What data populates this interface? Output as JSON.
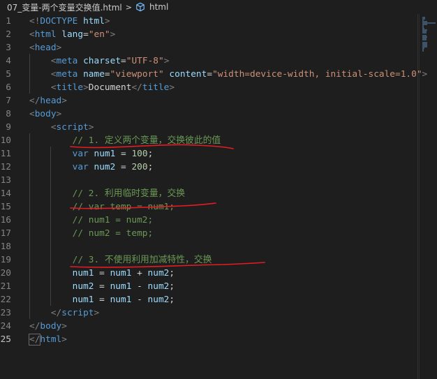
{
  "breadcrumb": {
    "file": "07_变量-两个变量交换值.html",
    "separator": ">",
    "item": "html"
  },
  "lines": [
    {
      "n": "1",
      "tokens": [
        [
          "tg",
          "<!"
        ],
        [
          "tn",
          "DOCTYPE"
        ],
        [
          "tx",
          " "
        ],
        [
          "an",
          "html"
        ],
        [
          "tg",
          ">"
        ]
      ]
    },
    {
      "n": "2",
      "tokens": [
        [
          "tg",
          "<"
        ],
        [
          "tn",
          "html"
        ],
        [
          "tx",
          " "
        ],
        [
          "an",
          "lang"
        ],
        [
          "tx",
          "="
        ],
        [
          "av",
          "\"en\""
        ],
        [
          "tg",
          ">"
        ]
      ]
    },
    {
      "n": "3",
      "tokens": [
        [
          "tg",
          "<"
        ],
        [
          "tn",
          "head"
        ],
        [
          "tg",
          ">"
        ]
      ]
    },
    {
      "n": "4",
      "tokens": [
        [
          "tx",
          "    "
        ],
        [
          "tg",
          "<"
        ],
        [
          "tn",
          "meta"
        ],
        [
          "tx",
          " "
        ],
        [
          "an",
          "charset"
        ],
        [
          "tx",
          "="
        ],
        [
          "av",
          "\"UTF-8\""
        ],
        [
          "tg",
          ">"
        ]
      ]
    },
    {
      "n": "5",
      "tokens": [
        [
          "tx",
          "    "
        ],
        [
          "tg",
          "<"
        ],
        [
          "tn",
          "meta"
        ],
        [
          "tx",
          " "
        ],
        [
          "an",
          "name"
        ],
        [
          "tx",
          "="
        ],
        [
          "av",
          "\"viewport\""
        ],
        [
          "tx",
          " "
        ],
        [
          "an",
          "content"
        ],
        [
          "tx",
          "="
        ],
        [
          "av",
          "\"width=device-width, initial-scale=1.0\""
        ],
        [
          "tg",
          ">"
        ]
      ]
    },
    {
      "n": "6",
      "tokens": [
        [
          "tx",
          "    "
        ],
        [
          "tg",
          "<"
        ],
        [
          "tn",
          "title"
        ],
        [
          "tg",
          ">"
        ],
        [
          "tx",
          "Document"
        ],
        [
          "tg",
          "</"
        ],
        [
          "tn",
          "title"
        ],
        [
          "tg",
          ">"
        ]
      ]
    },
    {
      "n": "7",
      "tokens": [
        [
          "tg",
          "</"
        ],
        [
          "tn",
          "head"
        ],
        [
          "tg",
          ">"
        ]
      ]
    },
    {
      "n": "8",
      "tokens": [
        [
          "tg",
          "<"
        ],
        [
          "tn",
          "body"
        ],
        [
          "tg",
          ">"
        ]
      ]
    },
    {
      "n": "9",
      "tokens": [
        [
          "tx",
          "    "
        ],
        [
          "tg",
          "<"
        ],
        [
          "tn",
          "script"
        ],
        [
          "tg",
          ">"
        ]
      ]
    },
    {
      "n": "10",
      "tokens": [
        [
          "tx",
          "        "
        ],
        [
          "cm",
          "// 1. 定义两个变量，交换彼此的值"
        ]
      ]
    },
    {
      "n": "11",
      "tokens": [
        [
          "tx",
          "        "
        ],
        [
          "dt",
          "var"
        ],
        [
          "tx",
          " "
        ],
        [
          "an",
          "num1"
        ],
        [
          "tx",
          " = "
        ],
        [
          "nm",
          "100"
        ],
        [
          "tx",
          ";"
        ]
      ]
    },
    {
      "n": "12",
      "tokens": [
        [
          "tx",
          "        "
        ],
        [
          "dt",
          "var"
        ],
        [
          "tx",
          " "
        ],
        [
          "an",
          "num2"
        ],
        [
          "tx",
          " = "
        ],
        [
          "nm",
          "200"
        ],
        [
          "tx",
          ";"
        ]
      ]
    },
    {
      "n": "13",
      "tokens": []
    },
    {
      "n": "14",
      "tokens": [
        [
          "tx",
          "        "
        ],
        [
          "cm",
          "// 2. 利用临时变量，交换"
        ]
      ]
    },
    {
      "n": "15",
      "tokens": [
        [
          "tx",
          "        "
        ],
        [
          "cm",
          "// var temp = num1;"
        ]
      ]
    },
    {
      "n": "16",
      "tokens": [
        [
          "tx",
          "        "
        ],
        [
          "cm",
          "// num1 = num2;"
        ]
      ]
    },
    {
      "n": "17",
      "tokens": [
        [
          "tx",
          "        "
        ],
        [
          "cm",
          "// num2 = temp;"
        ]
      ]
    },
    {
      "n": "18",
      "tokens": []
    },
    {
      "n": "19",
      "tokens": [
        [
          "tx",
          "        "
        ],
        [
          "cm",
          "// 3. 不使用利用加减特性，交换"
        ]
      ]
    },
    {
      "n": "20",
      "tokens": [
        [
          "tx",
          "        "
        ],
        [
          "an",
          "num1"
        ],
        [
          "tx",
          " = "
        ],
        [
          "an",
          "num1"
        ],
        [
          "tx",
          " + "
        ],
        [
          "an",
          "num2"
        ],
        [
          "tx",
          ";"
        ]
      ]
    },
    {
      "n": "21",
      "tokens": [
        [
          "tx",
          "        "
        ],
        [
          "an",
          "num2"
        ],
        [
          "tx",
          " = "
        ],
        [
          "an",
          "num1"
        ],
        [
          "tx",
          " - "
        ],
        [
          "an",
          "num2"
        ],
        [
          "tx",
          ";"
        ]
      ]
    },
    {
      "n": "22",
      "tokens": [
        [
          "tx",
          "        "
        ],
        [
          "an",
          "num1"
        ],
        [
          "tx",
          " = "
        ],
        [
          "an",
          "num1"
        ],
        [
          "tx",
          " - "
        ],
        [
          "an",
          "num2"
        ],
        [
          "tx",
          ";"
        ]
      ]
    },
    {
      "n": "23",
      "tokens": [
        [
          "tx",
          "    "
        ],
        [
          "tg",
          "</"
        ],
        [
          "tn",
          "script"
        ],
        [
          "tg",
          ">"
        ]
      ]
    },
    {
      "n": "24",
      "tokens": [
        [
          "tg",
          "</"
        ],
        [
          "tn",
          "body"
        ],
        [
          "tg",
          ">"
        ]
      ]
    },
    {
      "n": "25",
      "tokens": [
        [
          "tg",
          "</"
        ],
        [
          "tn",
          "html"
        ],
        [
          "tg",
          ">"
        ]
      ]
    }
  ],
  "colors": {
    "background": "#1e1e1e",
    "annotation": "#e51c23"
  },
  "icons": {
    "breadcrumb_chevron": "chevron-right-icon",
    "breadcrumb_symbol": "html-element-icon"
  }
}
